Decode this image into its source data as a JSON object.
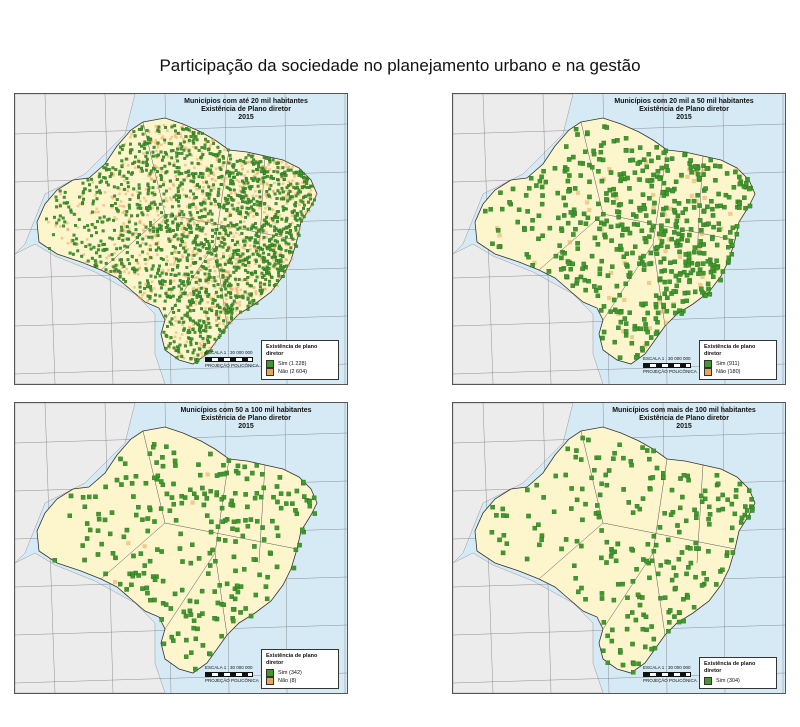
{
  "page_title": "Participação da sociedade no planejamento urbano e na gestão",
  "colors": {
    "ocean": "#d6eaf6",
    "brazil_land": "#fdf6cc",
    "neighbor_land": "#ececec",
    "sim": "#3f9a2e",
    "nao": "#e8a55a",
    "state_border": "#555555"
  },
  "scale_text": "ESCALA 1 : 30 000 000",
  "projection_text": "PROJEÇÃO POLICÔNICA",
  "panels": [
    {
      "title": [
        "Municípios com até 20 mil habitantes",
        "Existência de Plano diretor",
        "2015"
      ],
      "legend": {
        "title": "Existência de plano diretor",
        "items": [
          {
            "label": "Sim (1 228)",
            "color": "#3f9a2e"
          },
          {
            "label": "Não (2 604)",
            "color": "#e8a55a"
          }
        ]
      }
    },
    {
      "title": [
        "Municípios com 20 mil a 50 mil habitantes",
        "Existência de Plano diretor",
        "2015"
      ],
      "legend": {
        "title": "Existência de plano diretor",
        "items": [
          {
            "label": "Sim (911)",
            "color": "#3f9a2e"
          },
          {
            "label": "Não (180)",
            "color": "#e8a55a"
          }
        ]
      }
    },
    {
      "title": [
        "Municípios com 50 a 100 mil habitantes",
        "Existência de Plano diretor",
        "2015"
      ],
      "legend": {
        "title": "Existência de plano diretor",
        "items": [
          {
            "label": "Sim (342)",
            "color": "#3f9a2e"
          },
          {
            "label": "Não (8)",
            "color": "#e8a55a"
          }
        ]
      }
    },
    {
      "title": [
        "Municípios com mais de 100 mil habitantes",
        "Existência de Plano diretor",
        "2015"
      ],
      "legend": {
        "title": "Existência de plano diretor",
        "items": [
          {
            "label": "Sim (304)",
            "color": "#3f9a2e"
          }
        ]
      }
    }
  ]
}
